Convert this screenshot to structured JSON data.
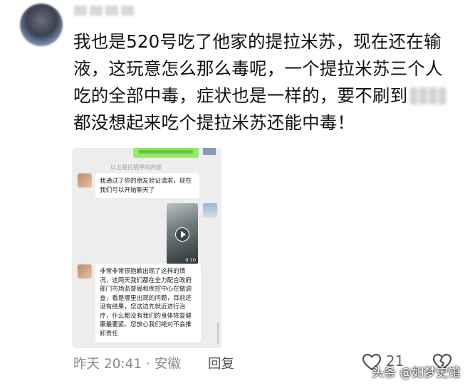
{
  "comment": {
    "lines": [
      "我也是520号吃了他家的提拉米苏，现在还在输",
      "液，这玩意怎么那么毒呢，一个提拉米苏三个人",
      "吃的全部中毒，症状也是一样的，要不刷到",
      "都没想起来吃个提拉米苏还能中毒！"
    ]
  },
  "chat": {
    "system_text": "以上是打招呼的内容",
    "message1": [
      "我通过了你的朋友验证请求，现在",
      "我们可以开始聊天了"
    ],
    "video_duration": "0:10",
    "message2": [
      "非常非常很抱歉出现了这样的情",
      "况，这两天我们都在全力配合政府",
      "部门市场监督局和疾控中心在做调",
      "查，看是哪里出现的问题，目前还",
      "没有结果，您这边先就近进行治",
      "疗，什么都没有我们的身体恢复健",
      "康最要紧。您放心我们绝对不会推",
      "卸责任"
    ]
  },
  "footer": {
    "meta": "昨天 20:41 · 安徽",
    "reply_label": "回复",
    "like_count": "21",
    "watermark": "头条 @如梦史馆"
  }
}
